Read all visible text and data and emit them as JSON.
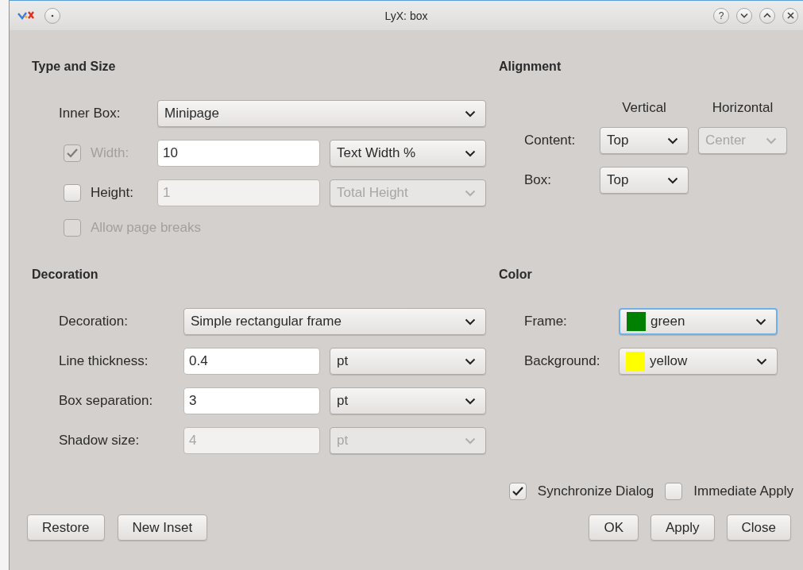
{
  "window": {
    "title": "LyX: box",
    "help": "?"
  },
  "type_and_size": {
    "title": "Type and Size",
    "rows": [
      {
        "kind": "combo",
        "label": "Inner Box:",
        "value": "Minipage",
        "disabled": false
      },
      {
        "kind": "check_measure",
        "label": "Width:",
        "checked": true,
        "check_disabled": true,
        "value": "10",
        "value_disabled": false,
        "unit": "Text Width %",
        "unit_disabled": false
      },
      {
        "kind": "check_measure",
        "label": "Height:",
        "checked": false,
        "check_disabled": false,
        "value": "1",
        "value_disabled": true,
        "unit": "Total Height",
        "unit_disabled": true
      },
      {
        "kind": "checkbox",
        "label": "Allow page breaks",
        "checked": false,
        "disabled": true
      }
    ]
  },
  "decoration": {
    "title": "Decoration",
    "rows": [
      {
        "kind": "combo",
        "label": "Decoration:",
        "value": "Simple rectangular frame",
        "disabled": false
      },
      {
        "kind": "measure",
        "label": "Line thickness:",
        "value": "0.4",
        "unit": "pt",
        "disabled": false
      },
      {
        "kind": "measure",
        "label": "Box separation:",
        "value": "3",
        "unit": "pt",
        "disabled": false
      },
      {
        "kind": "measure",
        "label": "Shadow size:",
        "value": "4",
        "unit": "pt",
        "disabled": true
      }
    ]
  },
  "alignment": {
    "title": "Alignment",
    "columns": [
      "Vertical",
      "Horizontal"
    ],
    "rows": [
      {
        "label": "Content:",
        "vertical": {
          "value": "Top",
          "disabled": false
        },
        "horizontal": {
          "value": "Center",
          "disabled": true
        }
      },
      {
        "label": "Box:",
        "vertical": {
          "value": "Top",
          "disabled": false
        }
      }
    ]
  },
  "color": {
    "title": "Color",
    "rows": [
      {
        "label": "Frame:",
        "value": "green",
        "color": "#008000",
        "focused": true
      },
      {
        "label": "Background:",
        "value": "yellow",
        "color": "#ffff00",
        "focused": false
      }
    ]
  },
  "options": [
    {
      "label": "Synchronize Dialog",
      "checked": true
    },
    {
      "label": "Immediate Apply",
      "checked": false
    }
  ],
  "buttons_left": [
    {
      "label": "Restore"
    },
    {
      "label": "New Inset"
    }
  ],
  "buttons_right": [
    {
      "label": "OK"
    },
    {
      "label": "Apply"
    },
    {
      "label": "Close"
    }
  ]
}
